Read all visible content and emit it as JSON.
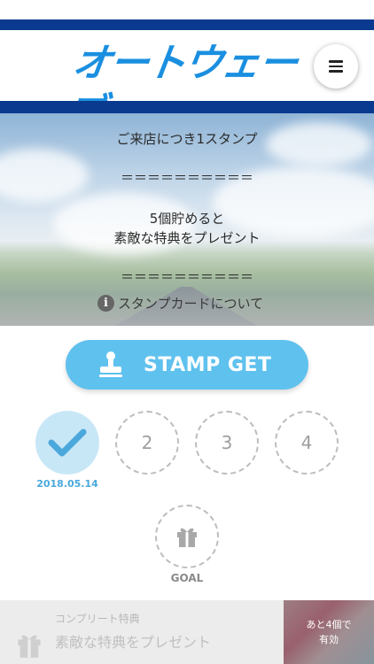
{
  "header": {
    "logo_text": "オートウェーブ",
    "brand_color": "#1a8fe0",
    "bar_color": "#0a3a8f",
    "menu_icon": "hamburger-icon"
  },
  "hero": {
    "line1": "ご来店につき1スタンプ",
    "divider1": "＝＝＝＝＝＝＝＝＝＝",
    "line2": "5個貯めると",
    "line3": "素敵な特典をプレゼント",
    "divider2": "＝＝＝＝＝＝＝＝＝＝",
    "info_icon": "info-icon",
    "info_link": "スタンプカードについて"
  },
  "stamp_button": {
    "label": "STAMP GET",
    "icon": "stamp-icon",
    "color": "#5fc1ee"
  },
  "stamps": {
    "slot1_date": "2018.05.14",
    "slot2_label": "2",
    "slot3_label": "3",
    "slot4_label": "4",
    "goal_label": "GOAL",
    "completed_count": 1,
    "total": 5
  },
  "reward": {
    "small_label": "コンプリート特典",
    "main_label": "素敵な特典をプレゼント",
    "remaining_line1": "あと4個で",
    "remaining_line2": "有効"
  }
}
